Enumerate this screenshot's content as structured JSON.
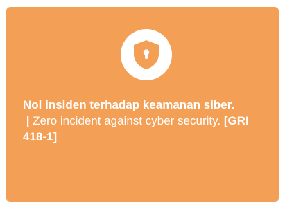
{
  "card": {
    "background": "#f39f55",
    "icon": "shield-lock-icon",
    "statement": {
      "id_text": "Nol insiden terhadap keamanan siber.",
      "separator": " | ",
      "en_text": "Zero incident against cyber security.",
      "reference": "[GRI 418-1]"
    }
  }
}
